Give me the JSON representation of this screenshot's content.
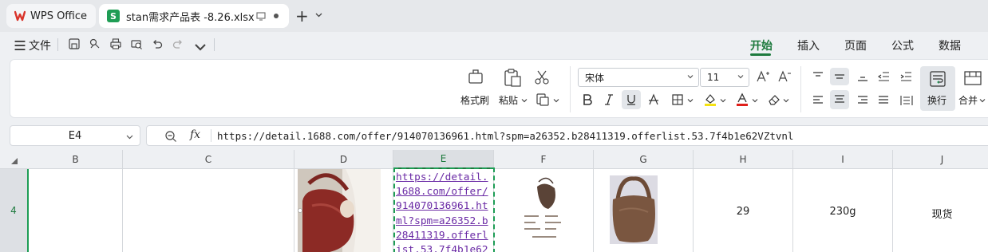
{
  "tabs": {
    "home": "WPS Office",
    "file": "stan需求产品表 -8.26.xlsx"
  },
  "menu": {
    "file_label": "文件",
    "ribbon_tabs": [
      "开始",
      "插入",
      "页面",
      "公式",
      "数据"
    ],
    "active_tab": "开始"
  },
  "ribbon": {
    "format_painter": "格式刷",
    "paste": "粘贴",
    "font_name": "宋体",
    "font_size": "11",
    "wrap": "换行",
    "merge": "合并"
  },
  "formula_bar": {
    "cell_ref": "E4",
    "fx": "fx",
    "content": "https://detail.1688.com/offer/914070136961.html?spm=a26352.b28411319.offerlist.53.7f4b1e62VZtvnl"
  },
  "grid": {
    "columns": [
      "B",
      "C",
      "D",
      "E",
      "F",
      "G",
      "H",
      "I",
      "J"
    ],
    "selected_column": "E",
    "row_number": "4",
    "cells": {
      "E": "https://detail.1688.com/offer/914070136961.html?spm=a26352.b28411319.offerlist.53.7f4b1e62",
      "H": "29",
      "I": "230g",
      "J": "现货"
    }
  },
  "colors": {
    "accent_green": "#1e7a3e",
    "link_purple": "#6a2aa5",
    "bag_red": "#8c2a25",
    "bag_brown": "#7a5640"
  }
}
